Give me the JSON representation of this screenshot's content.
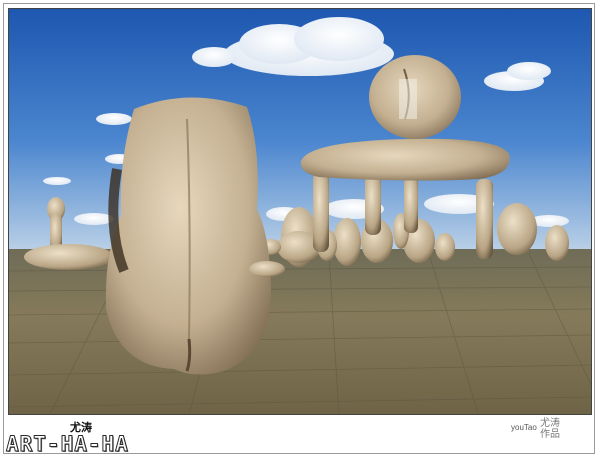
{
  "watermark": {
    "name_cn": "尤涛",
    "brand": "ART-HA-HA",
    "author": "youTao",
    "works_cn": "尤涛作品"
  },
  "colors": {
    "sky_top": "#1f5fb8",
    "sky_bottom": "#a9c6e6",
    "ground": "#7a7256",
    "figure": "#c9b79a"
  }
}
